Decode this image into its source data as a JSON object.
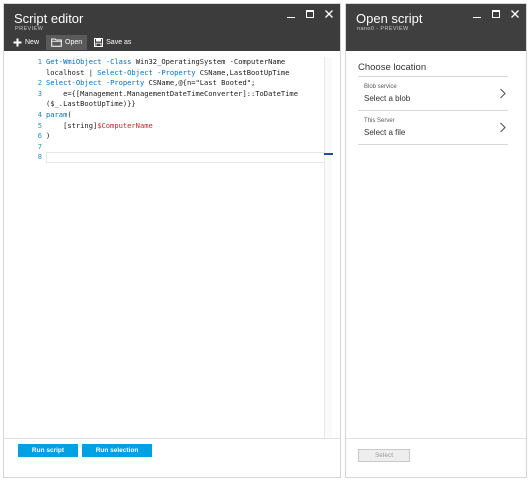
{
  "editor_blade": {
    "title": "Script editor",
    "subtitle": "PREVIEW",
    "toolbar": {
      "new_label": "New",
      "open_label": "Open",
      "save_label": "Save as"
    },
    "code_lines": [
      {
        "n": "1",
        "tokens": [
          {
            "t": "Get-WmiObject",
            "c": "tk-blue"
          },
          {
            "t": " ",
            "c": "tk-plain"
          },
          {
            "t": "-Class",
            "c": "tk-blue"
          },
          {
            "t": " Win32_OperatingSystem -ComputerName",
            "c": "tk-plain"
          }
        ]
      },
      {
        "n": "",
        "tokens": [
          {
            "t": "localhost | ",
            "c": "tk-plain"
          },
          {
            "t": "Select-Object",
            "c": "tk-blue"
          },
          {
            "t": " ",
            "c": "tk-plain"
          },
          {
            "t": "-Property",
            "c": "tk-blue"
          },
          {
            "t": " CSName,LastBootUpTime",
            "c": "tk-plain"
          }
        ]
      },
      {
        "n": "2",
        "tokens": [
          {
            "t": "Select-Object",
            "c": "tk-blue"
          },
          {
            "t": " ",
            "c": "tk-plain"
          },
          {
            "t": "-Property",
            "c": "tk-blue"
          },
          {
            "t": " CSName,@{n=\"Last Booted\";",
            "c": "tk-plain"
          }
        ]
      },
      {
        "n": "3",
        "tokens": [
          {
            "t": "    e={[Management.ManagementDateTimeConverter]::ToDateTime",
            "c": "tk-plain"
          }
        ]
      },
      {
        "n": "",
        "tokens": [
          {
            "t": "($_.LastBootUpTime)}}",
            "c": "tk-plain"
          }
        ]
      },
      {
        "n": "4",
        "tokens": [
          {
            "t": "param",
            "c": "tk-blue"
          },
          {
            "t": "(",
            "c": "tk-plain"
          }
        ]
      },
      {
        "n": "5",
        "tokens": [
          {
            "t": "    [string]",
            "c": "tk-plain"
          },
          {
            "t": "$ComputerName",
            "c": "tk-red"
          }
        ]
      },
      {
        "n": "6",
        "tokens": [
          {
            "t": ")",
            "c": "tk-plain"
          }
        ]
      },
      {
        "n": "7",
        "tokens": []
      },
      {
        "n": "8",
        "tokens": []
      }
    ],
    "current_line": "8",
    "run_script_label": "Run script",
    "run_selection_label": "Run selection"
  },
  "open_blade": {
    "title": "Open script",
    "subtitle": "nano0 - PREVIEW",
    "choose_title": "Choose location",
    "locations": [
      {
        "label": "Blob service",
        "value": "Select a blob"
      },
      {
        "label": "This Server",
        "value": "Select a file"
      }
    ],
    "select_label": "Select"
  },
  "icons": {
    "new": "plus-icon",
    "open": "folder-icon",
    "save": "floppy-disk-icon",
    "minimize": "minimize-icon",
    "maximize": "maximize-icon",
    "close": "close-icon",
    "chevron": "chevron-right-icon"
  },
  "colors": {
    "header_bg": "#3c3c3c",
    "accent": "#00a0e3",
    "keyword": "#0070c0",
    "variable": "#c0282b",
    "line_number": "#2b91af"
  }
}
